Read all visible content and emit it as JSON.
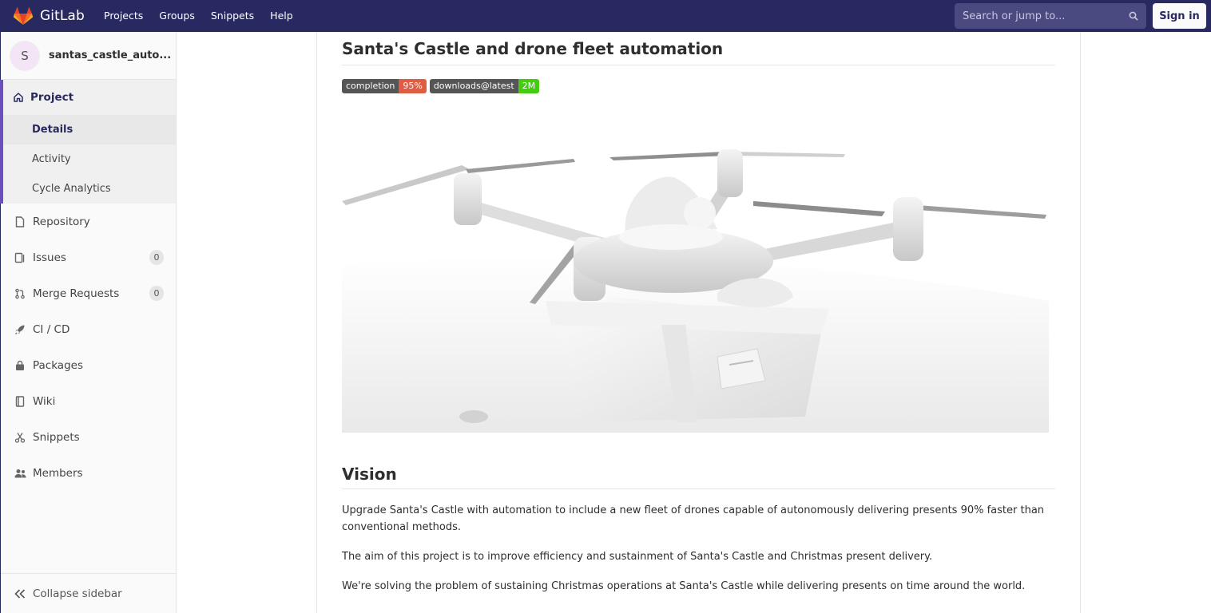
{
  "navbar": {
    "brand": "GitLab",
    "links": [
      "Projects",
      "Groups",
      "Snippets",
      "Help"
    ],
    "search_placeholder": "Search or jump to...",
    "sign_in": "Sign in"
  },
  "sidebar": {
    "avatar_letter": "S",
    "project_name": "santas_castle_auto...",
    "project_section": {
      "label": "Project",
      "items": [
        "Details",
        "Activity",
        "Cycle Analytics"
      ]
    },
    "items": [
      {
        "label": "Repository",
        "icon": "document-icon"
      },
      {
        "label": "Issues",
        "icon": "issues-icon",
        "count": "0"
      },
      {
        "label": "Merge Requests",
        "icon": "merge-request-icon",
        "count": "0"
      },
      {
        "label": "CI / CD",
        "icon": "rocket-icon"
      },
      {
        "label": "Packages",
        "icon": "package-icon"
      },
      {
        "label": "Wiki",
        "icon": "book-icon"
      },
      {
        "label": "Snippets",
        "icon": "scissors-icon"
      },
      {
        "label": "Members",
        "icon": "users-icon"
      }
    ],
    "collapse_label": "Collapse sidebar"
  },
  "main": {
    "title": "Santa's Castle and drone fleet automation",
    "badges": [
      {
        "key": "completion",
        "value": "95%",
        "color": "#e05d44"
      },
      {
        "key": "downloads@latest",
        "value": "2M",
        "color": "#4c1"
      }
    ],
    "vision_heading": "Vision",
    "paragraphs": [
      "Upgrade Santa's Castle with automation to include a new fleet of drones capable of autonomously delivering presents 90% faster than conventional methods.",
      "The aim of this project is to improve efficiency and sustainment of Santa's Castle and Christmas present delivery.",
      "We're solving the problem of sustaining Christmas operations at Santa's Castle while delivering presents on time around the world."
    ]
  },
  "colors": {
    "navbar": "#292961",
    "accent": "#6b4fbb"
  }
}
